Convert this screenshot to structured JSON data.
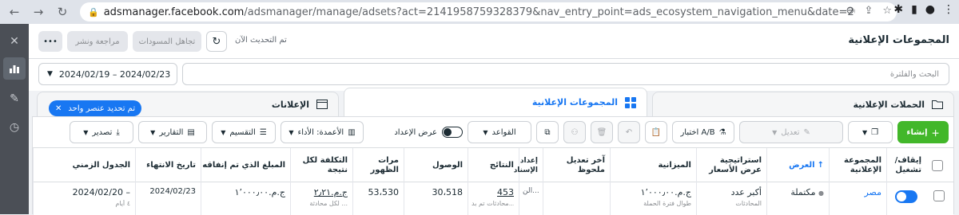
{
  "browser": {
    "url_domain": "adsmanager.facebook.com",
    "url_rest": "/adsmanager/manage/adsets?act=2141958759328379&nav_entry_point=ads_ecosystem_navigation_menu&date=2024-02-19_202..."
  },
  "header": {
    "page_title": "المجموعات الإعلانية",
    "review_publish": "مراجعة ونشر",
    "discard_drafts": "تجاهل المسودات",
    "updated_now": "تم التحديث الآن"
  },
  "search": {
    "placeholder": "البحث والفلترة",
    "date_range": "2024/02/19 – 2024/02/23"
  },
  "tabs": {
    "campaigns": "الحملات الإعلانية",
    "adsets": "المجموعات الإعلانية",
    "ads": "الإعلانات",
    "selected_pill": "تم تحديد عنصر واحد"
  },
  "toolbar": {
    "create": "إنشاء",
    "edit": "تعديل",
    "ab_test": "اختبار A/B",
    "rules": "القواعد",
    "setup_view": "عرض الإعداد",
    "columns": "الأعمدة: الأداء",
    "breakdown": "التقسيم",
    "reports": "التقارير",
    "export": "تصدير"
  },
  "table": {
    "headers": {
      "onoff": "إيقاف/ تشغيل",
      "adset": "المجموعة الإعلانية",
      "delivery": "العرض",
      "bid_strategy": "استراتيجية عرض الأسعار",
      "budget": "الميزانية",
      "last_edit": "آخر تعديل ملحوظ",
      "attribution": "إعداد الإسناد",
      "results": "النتائج",
      "reach": "الوصول",
      "impressions": "مرات الظهور",
      "cost_per_result": "التكلفة لكل نتيجة",
      "amount_spent": "المبلغ الذي تم إنفاقه",
      "ends": "تاريخ الانتهاء",
      "schedule": "الجدول الزمني"
    },
    "row": {
      "adset": "مصر",
      "delivery": "مكتملة",
      "bid_strategy": "أكبر عدد",
      "bid_strategy_sub": "المحادثات",
      "budget": "ج.م.‏١٬٠٠٠٫٠٠",
      "budget_sub": "طوال فترة الحملة",
      "last_edit": "",
      "attribution": "الن...",
      "results": "453",
      "results_sub": "محادثات تم بد...",
      "reach": "30،518",
      "impressions": "53،530",
      "cost_per_result": "ج.م.‏٢٫٢١",
      "cost_per_result_sub": "لكل محادثة ...",
      "amount_spent": "ج.م.‏١٬٠٠٠٫٠٠",
      "ends": "2024/02/23",
      "schedule": "2024/02/20 –",
      "schedule_sub": "٤ أيام"
    }
  }
}
